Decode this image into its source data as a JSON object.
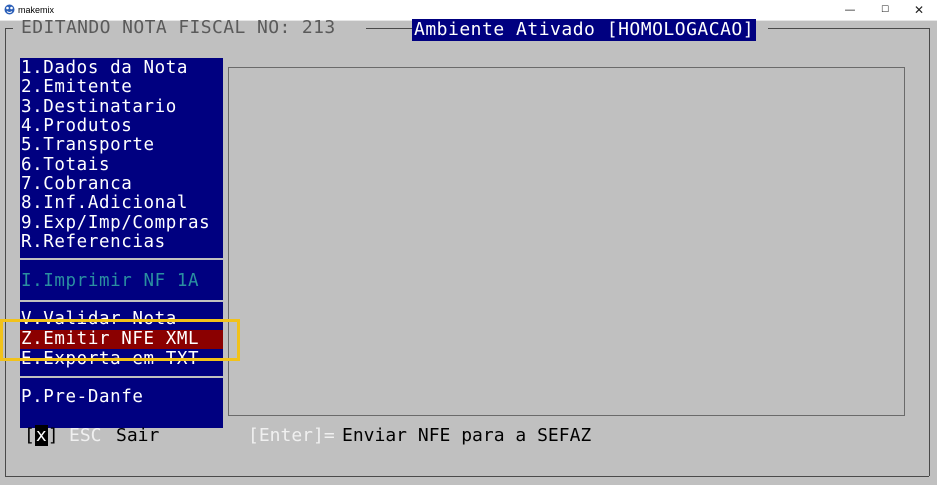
{
  "window": {
    "title": "makemix",
    "minimize_icon": "minimize-icon",
    "maximize_icon": "maximize-icon",
    "close_icon": "close-icon",
    "minimize_glyph": "—",
    "maximize_glyph": "☐",
    "close_glyph": "✕"
  },
  "header": {
    "title": "EDITANDO NOTA FISCAL NO: 213",
    "environment": "Ambiente Ativado [HOMOLOGACAO]"
  },
  "menu": {
    "items": [
      {
        "key": "1",
        "label": "1.Dados da Nota"
      },
      {
        "key": "2",
        "label": "2.Emitente"
      },
      {
        "key": "3",
        "label": "3.Destinatario"
      },
      {
        "key": "4",
        "label": "4.Produtos"
      },
      {
        "key": "5",
        "label": "5.Transporte"
      },
      {
        "key": "6",
        "label": "6.Totais"
      },
      {
        "key": "7",
        "label": "7.Cobranca"
      },
      {
        "key": "8",
        "label": "8.Inf.Adicional"
      },
      {
        "key": "9",
        "label": "9.Exp/Imp/Compras"
      },
      {
        "key": "R",
        "label": "R.Referencias"
      }
    ],
    "print_item": "I.Imprimir NF 1A",
    "validate_item": "V.Validar Nota",
    "emit_item": "Z.Emitir NFE XML",
    "export_item": "E.Exporta em TXT",
    "predanfe_item": "P.Pre-Danfe",
    "selected": "Z.Emitir NFE XML"
  },
  "footer": {
    "checkbox_open": "[",
    "checkbox_mark": "x",
    "checkbox_close": "]",
    "esc_key": "ESC",
    "esc_label": "Sair",
    "enter_key": "[Enter]=",
    "enter_label": "Enviar NFE para a SEFAZ"
  },
  "colors": {
    "background": "#c0c0c0",
    "menu_bg": "#000080",
    "selected_bg": "#8b0000",
    "highlight": "#f2c21a",
    "disabled_text": "#2a8fa0"
  }
}
